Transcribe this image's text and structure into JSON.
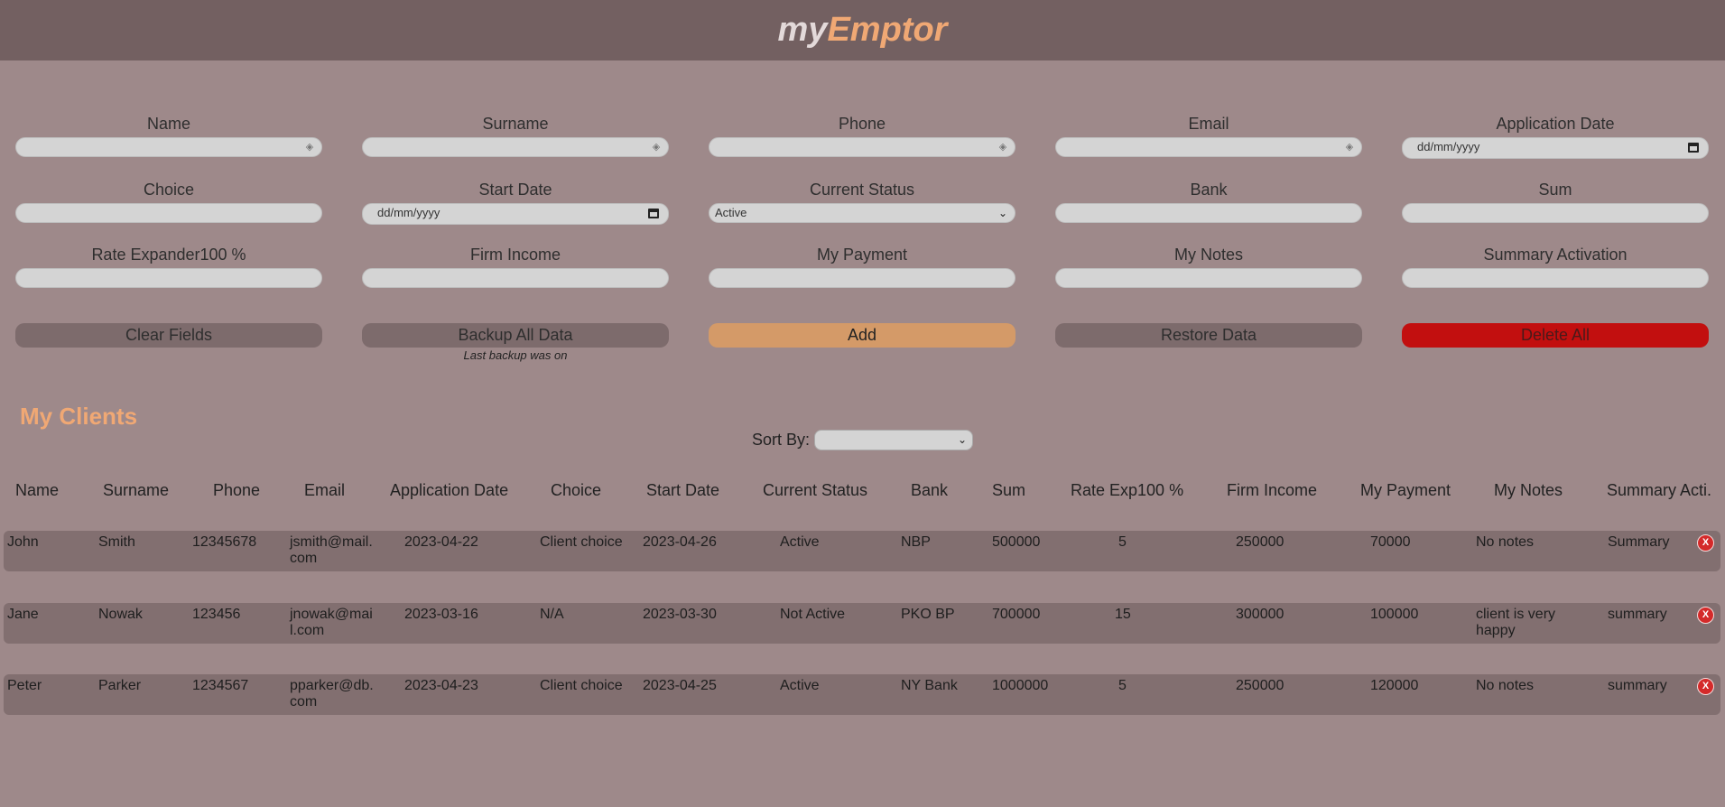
{
  "header": {
    "logo_part1": "my",
    "logo_part2": "Emptor"
  },
  "form": {
    "fields": [
      {
        "label": "Name",
        "value": ""
      },
      {
        "label": "Surname",
        "value": ""
      },
      {
        "label": "Phone",
        "value": ""
      },
      {
        "label": "Email",
        "value": ""
      },
      {
        "label": "Application Date",
        "value": "dd/mm/yyyy"
      },
      {
        "label": "Choice",
        "value": ""
      },
      {
        "label": "Start Date",
        "value": "dd/mm/yyyy"
      },
      {
        "label": "Current Status",
        "value": "Active"
      },
      {
        "label": "Bank",
        "value": ""
      },
      {
        "label": "Sum",
        "value": ""
      },
      {
        "label": "Rate Expander100 %",
        "value": ""
      },
      {
        "label": "Firm Income",
        "value": ""
      },
      {
        "label": "My Payment",
        "value": ""
      },
      {
        "label": "My Notes",
        "value": ""
      },
      {
        "label": "Summary Activation",
        "value": ""
      }
    ],
    "buttons": {
      "clear": "Clear Fields",
      "backup": "Backup All Data",
      "add": "Add",
      "restore": "Restore Data",
      "delete_all": "Delete All"
    },
    "backup_note": "Last backup was on"
  },
  "clients": {
    "title": "My Clients",
    "sort_label": "Sort By:",
    "sort_value": "",
    "columns": [
      "Name",
      "Surname",
      "Phone",
      "Email",
      "Application Date",
      "Choice",
      "Start Date",
      "Current Status",
      "Bank",
      "Sum",
      "Rate Exp100 %",
      "Firm Income",
      "My Payment",
      "My Notes",
      "Summary Acti."
    ],
    "rows": [
      {
        "name": "John",
        "surname": "Smith",
        "phone": "12345678",
        "email_l1": "jsmith@mail.",
        "email_l2": "com",
        "app_date": "2023-04-22",
        "choice": "Client choice",
        "start_date": "2023-04-26",
        "status": "Active",
        "bank": "NBP",
        "sum": "500000",
        "rate": "5",
        "firm_income": "250000",
        "my_payment": "70000",
        "notes_l1": "No notes",
        "notes_l2": "",
        "summary": "Summary",
        "delete_label": "X"
      },
      {
        "name": "Jane",
        "surname": "Nowak",
        "phone": "123456",
        "email_l1": "jnowak@mai",
        "email_l2": "l.com",
        "app_date": "2023-03-16",
        "choice": "N/A",
        "start_date": "2023-03-30",
        "status": "Not Active",
        "bank": "PKO BP",
        "sum": "700000",
        "rate": "15",
        "firm_income": "300000",
        "my_payment": "100000",
        "notes_l1": "client is very",
        "notes_l2": "happy",
        "summary": "summary",
        "delete_label": "X"
      },
      {
        "name": "Peter",
        "surname": "Parker",
        "phone": "1234567",
        "email_l1": "pparker@db.",
        "email_l2": "com",
        "app_date": "2023-04-23",
        "choice": "Client choice",
        "start_date": "2023-04-25",
        "status": "Active",
        "bank": "NY Bank",
        "sum": "1000000",
        "rate": "5",
        "firm_income": "250000",
        "my_payment": "120000",
        "notes_l1": "No notes",
        "notes_l2": "",
        "summary": "summary",
        "delete_label": "X"
      }
    ]
  }
}
